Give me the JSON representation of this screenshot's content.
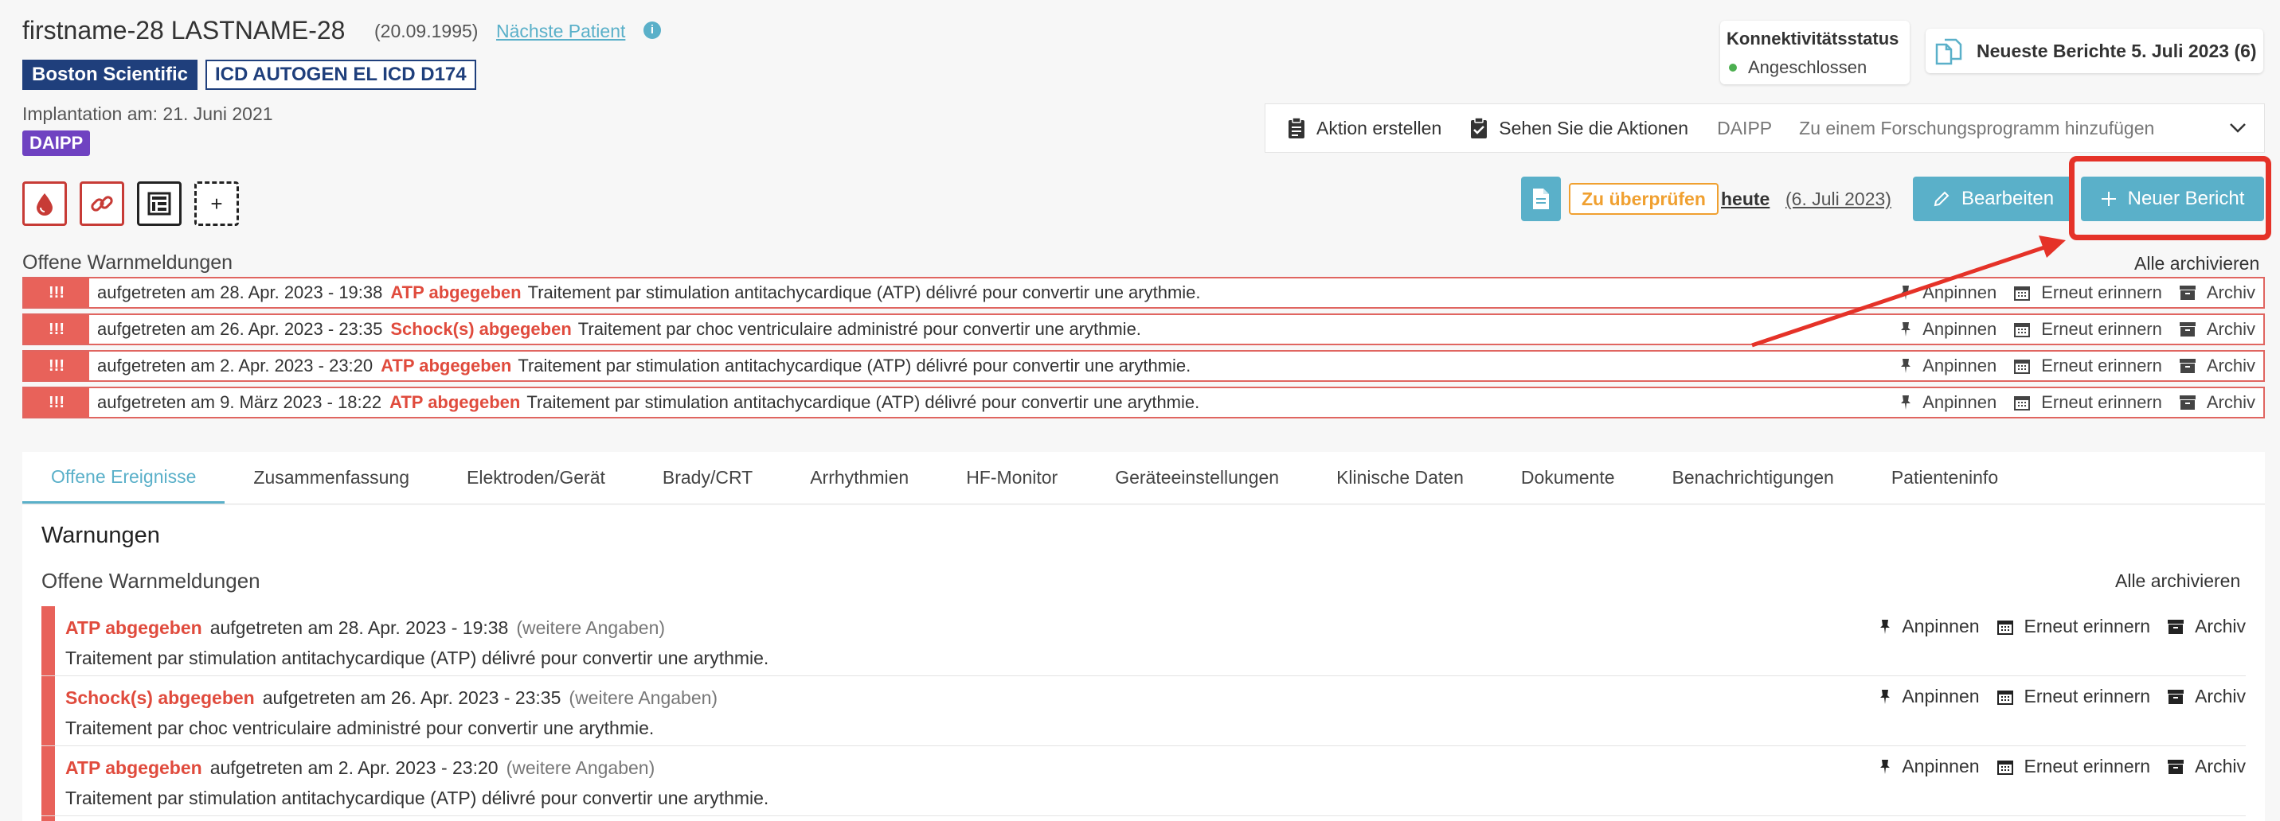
{
  "header": {
    "patient_name": "firstname-28 LASTNAME-28",
    "dob": "(20.09.1995)",
    "next_patient": "Nächste Patient",
    "brand": "Boston Scientific",
    "device": "ICD AUTOGEN EL ICD D174",
    "implant_date": "Implantation am: 21. Juni 2021",
    "program_badge": "DAIPP",
    "add_icon": "+"
  },
  "connectivity": {
    "title": "Konnektivitätsstatus",
    "status": "Angeschlossen"
  },
  "latest_reports": "Neueste Berichte 5. Juli 2023 (6)",
  "actions": {
    "create": "Aktion erstellen",
    "view": "Sehen Sie die Aktionen",
    "program": "DAIPP",
    "add_research": "Zu einem Forschungsprogramm hinzufügen"
  },
  "review": {
    "badge": "Zu überprüfen",
    "today": "heute",
    "date": "(6. Juli 2023)",
    "edit": "Bearbeiten",
    "new_report": "Neuer Bericht"
  },
  "top_alerts": {
    "title": "Offene Warnmeldungen",
    "archive_all": "Alle archivieren",
    "mark": "!!!",
    "items": [
      {
        "date": "aufgetreten am 28. Apr. 2023 - 19:38",
        "type": "ATP abgegeben",
        "desc": "Traitement par stimulation antitachycardique (ATP) délivré pour convertir une arythmie."
      },
      {
        "date": "aufgetreten am 26. Apr. 2023 - 23:35",
        "type": "Schock(s) abgegeben",
        "desc": "Traitement par choc ventriculaire administré pour convertir une arythmie."
      },
      {
        "date": "aufgetreten am 2. Apr. 2023 - 23:20",
        "type": "ATP abgegeben",
        "desc": "Traitement par stimulation antitachycardique (ATP) délivré pour convertir une arythmie."
      },
      {
        "date": "aufgetreten am 9. März 2023 - 18:22",
        "type": "ATP abgegeben",
        "desc": "Traitement par stimulation antitachycardique (ATP) délivré pour convertir une arythmie."
      }
    ]
  },
  "alert_actions": {
    "pin": "Anpinnen",
    "remind": "Erneut erinnern",
    "archive": "Archiv"
  },
  "tabs": [
    "Offene Ereignisse",
    "Zusammenfassung",
    "Elektroden/Gerät",
    "Brady/CRT",
    "Arrhythmien",
    "HF-Monitor",
    "Geräteeinstellungen",
    "Klinische Daten",
    "Dokumente",
    "Benachrichtigungen",
    "Patienteninfo"
  ],
  "warnings": {
    "title": "Warnungen",
    "subtitle": "Offene Warnmeldungen",
    "archive_all": "Alle archivieren",
    "more": "(weitere Angaben)",
    "items": [
      {
        "type": "ATP abgegeben",
        "date": "aufgetreten am 28. Apr. 2023 - 19:38",
        "desc": "Traitement par stimulation antitachycardique (ATP) délivré pour convertir une arythmie."
      },
      {
        "type": "Schock(s) abgegeben",
        "date": "aufgetreten am 26. Apr. 2023 - 23:35",
        "desc": "Traitement par choc ventriculaire administré pour convertir une arythmie."
      },
      {
        "type": "ATP abgegeben",
        "date": "aufgetreten am 2. Apr. 2023 - 23:20",
        "desc": "Traitement par stimulation antitachycardique (ATP) délivré pour convertir une arythmie."
      }
    ]
  },
  "colors": {
    "accent": "#5ab0c9",
    "alert": "#e8625a",
    "brand": "#1f3f7c",
    "warning": "#f0a030",
    "highlight": "#e53228"
  }
}
